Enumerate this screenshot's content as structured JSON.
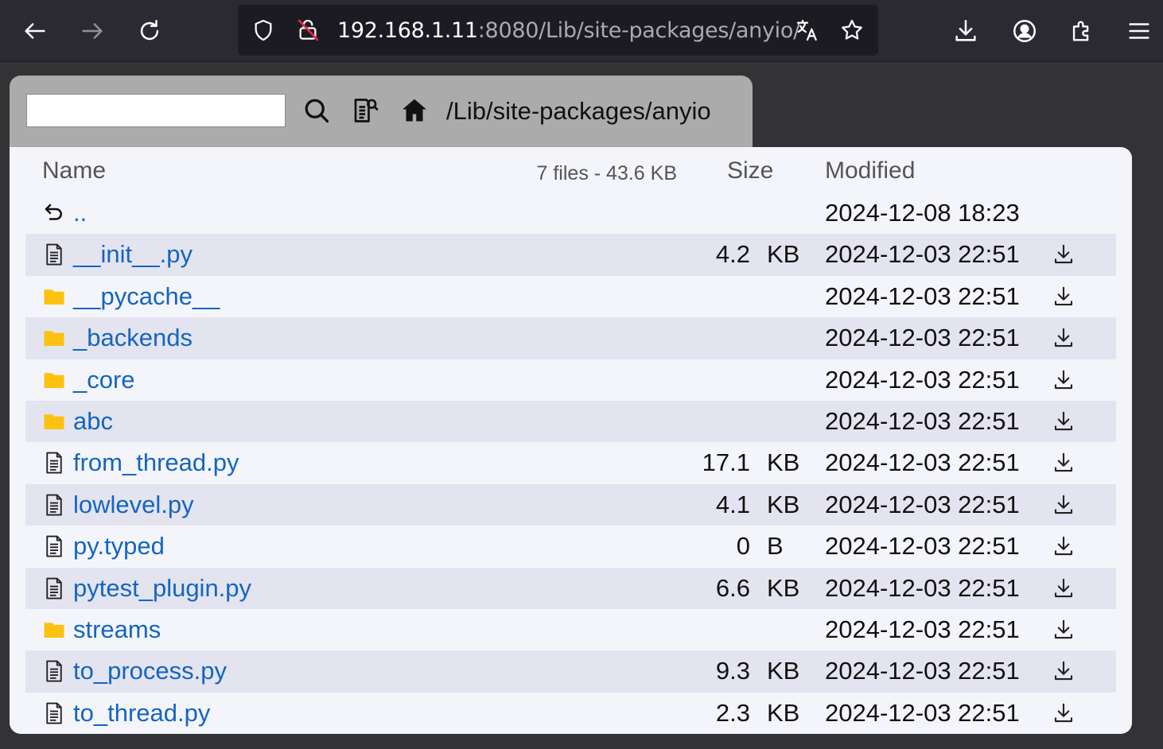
{
  "browser": {
    "url_host": "192.168.1.11",
    "url_path": ":8080/Lib/site-packages/anyio/"
  },
  "toolbar": {
    "search_value": "",
    "path": "/Lib/site-packages/anyio"
  },
  "table": {
    "col_name": "Name",
    "summary": "7 files - 43.6 KB",
    "col_size": "Size",
    "col_modified": "Modified"
  },
  "rows": [
    {
      "type": "parent",
      "name": "..",
      "size": "",
      "unit": "",
      "modified": "2024-12-08 18:23",
      "download": false
    },
    {
      "type": "file",
      "name": "__init__.py",
      "size": "4.2",
      "unit": "KB",
      "modified": "2024-12-03 22:51",
      "download": true
    },
    {
      "type": "folder",
      "name": "__pycache__",
      "size": "",
      "unit": "",
      "modified": "2024-12-03 22:51",
      "download": true
    },
    {
      "type": "folder",
      "name": "_backends",
      "size": "",
      "unit": "",
      "modified": "2024-12-03 22:51",
      "download": true
    },
    {
      "type": "folder",
      "name": "_core",
      "size": "",
      "unit": "",
      "modified": "2024-12-03 22:51",
      "download": true
    },
    {
      "type": "folder",
      "name": "abc",
      "size": "",
      "unit": "",
      "modified": "2024-12-03 22:51",
      "download": true
    },
    {
      "type": "file",
      "name": "from_thread.py",
      "size": "17.1",
      "unit": "KB",
      "modified": "2024-12-03 22:51",
      "download": true
    },
    {
      "type": "file",
      "name": "lowlevel.py",
      "size": "4.1",
      "unit": "KB",
      "modified": "2024-12-03 22:51",
      "download": true
    },
    {
      "type": "file",
      "name": "py.typed",
      "size": "0",
      "unit": "B",
      "modified": "2024-12-03 22:51",
      "download": true
    },
    {
      "type": "file",
      "name": "pytest_plugin.py",
      "size": "6.6",
      "unit": "KB",
      "modified": "2024-12-03 22:51",
      "download": true
    },
    {
      "type": "folder",
      "name": "streams",
      "size": "",
      "unit": "",
      "modified": "2024-12-03 22:51",
      "download": true
    },
    {
      "type": "file",
      "name": "to_process.py",
      "size": "9.3",
      "unit": "KB",
      "modified": "2024-12-03 22:51",
      "download": true
    },
    {
      "type": "file",
      "name": "to_thread.py",
      "size": "2.3",
      "unit": "KB",
      "modified": "2024-12-03 22:51",
      "download": true
    }
  ],
  "colors": {
    "link": "#1565c0",
    "folder": "#fcc20f",
    "row_alt": "#e3e4ef",
    "panel": "#f4f5fb",
    "topbar": "#ababab"
  }
}
